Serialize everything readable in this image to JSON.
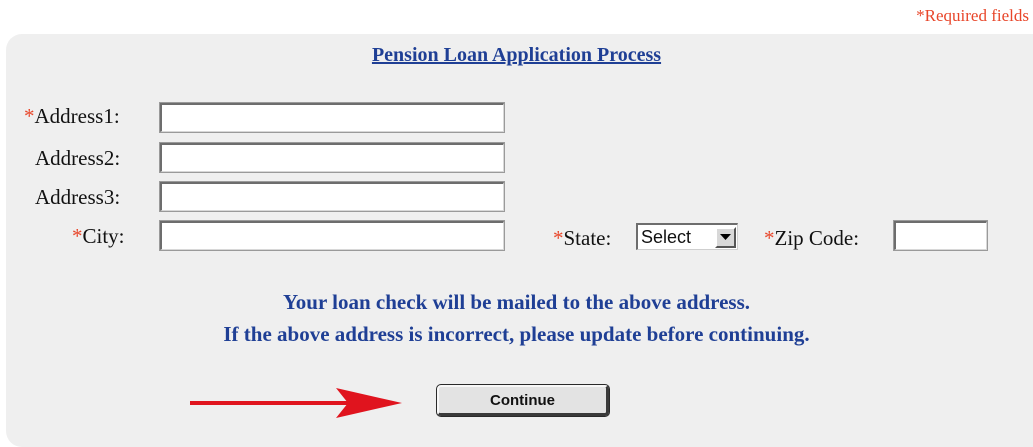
{
  "required_note": "*Required fields",
  "title": "Pension Loan Application Process",
  "form": {
    "address1": {
      "star": "*",
      "label": "Address1:",
      "value": ""
    },
    "address2": {
      "label": "Address2:",
      "value": ""
    },
    "address3": {
      "label": "Address3:",
      "value": ""
    },
    "city": {
      "star": "*",
      "label": "City:",
      "value": ""
    },
    "state": {
      "star": "*",
      "label": "State:",
      "selected": "Select"
    },
    "zip": {
      "star": "*",
      "label": "Zip Code:",
      "value": ""
    }
  },
  "message": {
    "line1": "Your loan check will be mailed to the above address.",
    "line2": "If the above address is incorrect, please update before continuing."
  },
  "continue_label": "Continue",
  "colors": {
    "required": "#e8462a",
    "title": "#1f3f95",
    "panel": "#efefef",
    "arrow": "#e0141e"
  },
  "icons": {
    "dropdown": "chevron-down-icon",
    "pointer": "red-arrow-icon"
  }
}
